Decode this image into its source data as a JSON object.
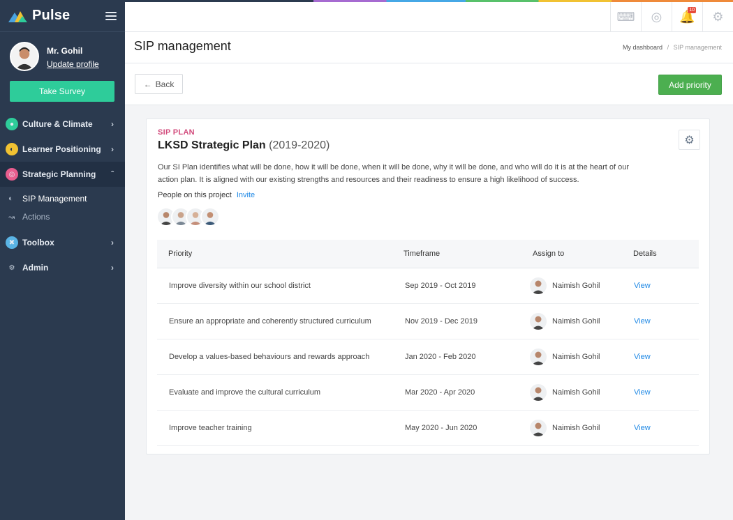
{
  "app": {
    "name": "Pulse",
    "user_name": "Mr. Gohil",
    "update_profile": "Update profile",
    "survey_button": "Take Survey"
  },
  "nav": {
    "items": [
      {
        "label": "Culture & Climate",
        "icon": "globe-icon",
        "color": "#2ecc9a"
      },
      {
        "label": "Learner Positioning",
        "icon": "chart-pie-icon",
        "color": "#f1c232"
      },
      {
        "label": "Strategic Planning",
        "icon": "target-icon",
        "color": "#e85d8e"
      },
      {
        "label": "Toolbox",
        "icon": "tools-icon",
        "color": "#5ab4e5"
      },
      {
        "label": "Admin",
        "icon": "gear-icon",
        "color": "#c7d0dc"
      }
    ],
    "sub_items": [
      {
        "label": "SIP Management",
        "icon": "pie-icon"
      },
      {
        "label": "Actions",
        "icon": "line-chart-icon"
      }
    ]
  },
  "topbar": {
    "notification_count": "10"
  },
  "page": {
    "title": "SIP management",
    "breadcrumb_home": "My dashboard",
    "breadcrumb_sep": "/",
    "breadcrumb_current": "SIP management",
    "back_label": "Back",
    "back_arrow": "←",
    "add_label": "Add priority"
  },
  "plan": {
    "kicker": "SIP PLAN",
    "title": "LKSD Strategic Plan",
    "years": "(2019-2020)",
    "description": "Our SI Plan identifies what will be done, how it will be done, when it will be done, why it will be done, and who will do it is at the heart of our action plan. It is aligned with our existing strengths and resources and their readiness to ensure a high likelihood of success.",
    "people_label": "People on this project",
    "invite_label": "Invite"
  },
  "table": {
    "headers": [
      "Priority",
      "Timeframe",
      "Assign to",
      "Details"
    ],
    "rows": [
      {
        "priority": "Improve diversity within our school district",
        "timeframe": "Sep 2019 - Oct 2019",
        "assignee": "Naimish Gohil",
        "details": "View"
      },
      {
        "priority": "Ensure an appropriate and coherently structured curriculum",
        "timeframe": "Nov 2019 - Dec 2019",
        "assignee": "Naimish Gohil",
        "details": "View"
      },
      {
        "priority": "Develop a values-based behaviours and rewards approach",
        "timeframe": "Jan 2020 - Feb 2020",
        "assignee": "Naimish Gohil",
        "details": "View"
      },
      {
        "priority": "Evaluate and improve the cultural curriculum",
        "timeframe": "Mar 2020 - Apr 2020",
        "assignee": "Naimish Gohil",
        "details": "View"
      },
      {
        "priority": "Improve teacher training",
        "timeframe": "May 2020 - Jun 2020",
        "assignee": "Naimish Gohil",
        "details": "View"
      }
    ]
  },
  "colors": {
    "sidebar": "#2b3a4f",
    "accent_green": "#2ecc9a",
    "primary_green": "#4caf50",
    "link_blue": "#1e88e5",
    "kicker_pink": "#d24b7c"
  }
}
